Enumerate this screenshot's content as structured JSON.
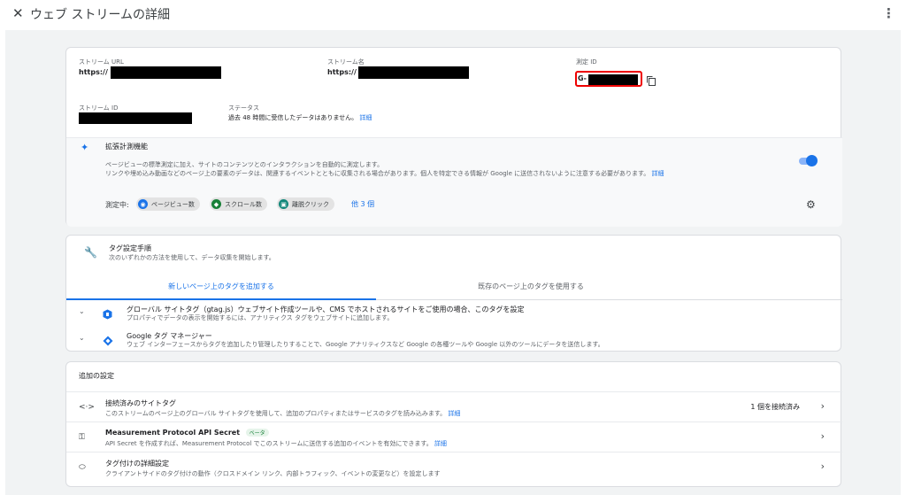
{
  "header": {
    "close_icon": "close-icon",
    "title": "ウェブ ストリームの詳細",
    "menu_icon": "more-vert-icon"
  },
  "stream": {
    "url_label": "ストリーム URL",
    "url_value": "https://",
    "name_label": "ストリーム名",
    "name_value": "https://",
    "mid_label": "測定 ID",
    "mid_value": "G-",
    "id_label": "ストリーム ID",
    "status_label": "ステータス",
    "status_text": "過去 48 時間に受信したデータはありません。",
    "status_link": "詳細"
  },
  "enhanced": {
    "title": "拡張計測機能",
    "desc1": "ページビューの標準測定に加え、サイトのコンテンツとのインタラクションを自動的に測定します。",
    "desc2": "リンクや埋め込み動画などのページ上の要素のデータは、関連するイベントとともに収集される場合があります。個人を特定できる情報が Google に送信されないように注意する必要があります。",
    "desc_link": "詳細",
    "toggle_on": true,
    "measuring_label": "測定中:",
    "chips": [
      "ページビュー数",
      "スクロール数",
      "離脱クリック"
    ],
    "more": "他 3 個",
    "accent": "#1a73e8"
  },
  "tags": {
    "title": "タグ設定手順",
    "subtitle": "次のいずれかの方法を使用して、データ収集を開始します。",
    "tab_new": "新しいページ上のタグを追加する",
    "tab_existing": "既存のページ上のタグを使用する",
    "options": [
      {
        "title": "グローバル サイトタグ（gtag.js）ウェブサイト作成ツールや、CMS でホストされるサイトをご使用の場合、このタグを設定",
        "desc": "プロパティでデータの表示を開始するには、アナリティクス タグをウェブサイトに追加します。"
      },
      {
        "title": "Google タグ マネージャー",
        "desc": "ウェブ インターフェースからタグを追加したり管理したりすることで、Google アナリティクスなど Google の各種ツールや Google 以外のツールにデータを送信します。"
      }
    ]
  },
  "additional": {
    "title": "追加の設定",
    "rows": [
      {
        "icon": "code-icon",
        "title": "接続済みのサイトタグ",
        "desc": "このストリームのページ上のグローバル サイトタグを使用して、追加のプロパティまたはサービスのタグを読み込みます。",
        "link": "詳細",
        "right": "1 個を接続済み"
      },
      {
        "icon": "key-icon",
        "title": "Measurement Protocol API Secret",
        "badge": "ベータ",
        "desc": "API Secret を作成すれば、Measurement Protocol でこのストリームに送信する追加のイベントを有効にできます。",
        "link": "詳細"
      },
      {
        "icon": "label-icon",
        "title": "タグ付けの詳細設定",
        "desc": "クライアントサイドのタグ付けの動作（クロスドメイン リンク、内部トラフィック、イベントの変更など）を設定します"
      }
    ]
  }
}
